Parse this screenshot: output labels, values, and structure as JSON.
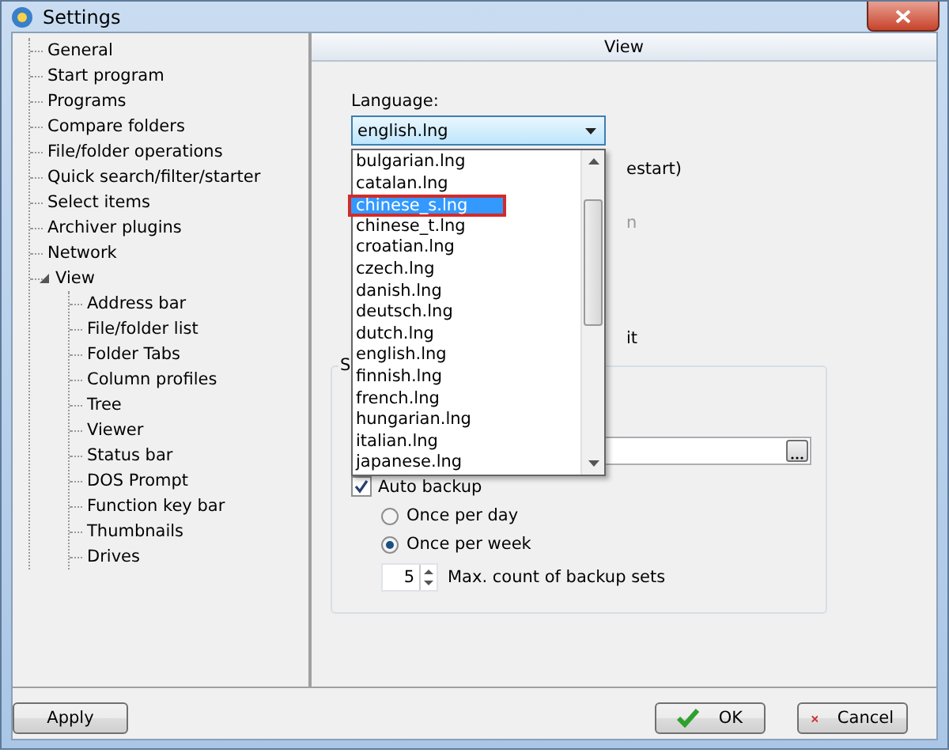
{
  "window": {
    "title": "Settings"
  },
  "tree": [
    {
      "label": "General"
    },
    {
      "label": "Start program"
    },
    {
      "label": "Programs"
    },
    {
      "label": "Compare folders"
    },
    {
      "label": "File/folder operations"
    },
    {
      "label": "Quick search/filter/starter"
    },
    {
      "label": "Select items"
    },
    {
      "label": "Archiver plugins"
    },
    {
      "label": "Network"
    },
    {
      "label": "View",
      "expanded": true,
      "children": [
        {
          "label": "Address bar"
        },
        {
          "label": "File/folder list"
        },
        {
          "label": "Folder Tabs"
        },
        {
          "label": "Column profiles"
        },
        {
          "label": "Tree"
        },
        {
          "label": "Viewer"
        },
        {
          "label": "Status bar"
        },
        {
          "label": "DOS Prompt"
        },
        {
          "label": "Function key bar"
        },
        {
          "label": "Thumbnails"
        },
        {
          "label": "Drives"
        }
      ]
    }
  ],
  "panel": {
    "title": "View"
  },
  "language": {
    "label": "Language:",
    "value": "english.lng",
    "open": true,
    "options": [
      {
        "label": "bulgarian.lng",
        "highlighted": false,
        "marked": false
      },
      {
        "label": "catalan.lng",
        "highlighted": false,
        "marked": false
      },
      {
        "label": "chinese_s.lng",
        "highlighted": true,
        "marked": true
      },
      {
        "label": "chinese_t.lng",
        "highlighted": false,
        "marked": false
      },
      {
        "label": "croatian.lng",
        "highlighted": false,
        "marked": false
      },
      {
        "label": "czech.lng",
        "highlighted": false,
        "marked": false
      },
      {
        "label": "danish.lng",
        "highlighted": false,
        "marked": false
      },
      {
        "label": "deutsch.lng",
        "highlighted": false,
        "marked": false
      },
      {
        "label": "dutch.lng",
        "highlighted": false,
        "marked": false
      },
      {
        "label": "english.lng",
        "highlighted": false,
        "marked": false
      },
      {
        "label": "finnish.lng",
        "highlighted": false,
        "marked": false
      },
      {
        "label": "french.lng",
        "highlighted": false,
        "marked": false
      },
      {
        "label": "hungarian.lng",
        "highlighted": false,
        "marked": false
      },
      {
        "label": "italian.lng",
        "highlighted": false,
        "marked": false
      },
      {
        "label": "japanese.lng",
        "highlighted": false,
        "marked": false
      }
    ]
  },
  "covered_options": [
    {
      "text": "estart)",
      "disabled": false
    },
    {
      "text": "n",
      "disabled": true
    },
    {
      "text": "it",
      "disabled": false
    }
  ],
  "backup_group": {
    "label": "S",
    "auto_backup": {
      "label": "Auto backup",
      "checked": true
    },
    "frequency": [
      {
        "label": "Once per day",
        "selected": false
      },
      {
        "label": "Once per week",
        "selected": true
      }
    ],
    "max_count": {
      "value": "5",
      "label": "Max. count of backup sets"
    }
  },
  "buttons": [
    {
      "label": "Apply",
      "kind": "plain"
    },
    {
      "label": "OK",
      "kind": "ok"
    },
    {
      "label": "Cancel",
      "kind": "cancel"
    }
  ]
}
